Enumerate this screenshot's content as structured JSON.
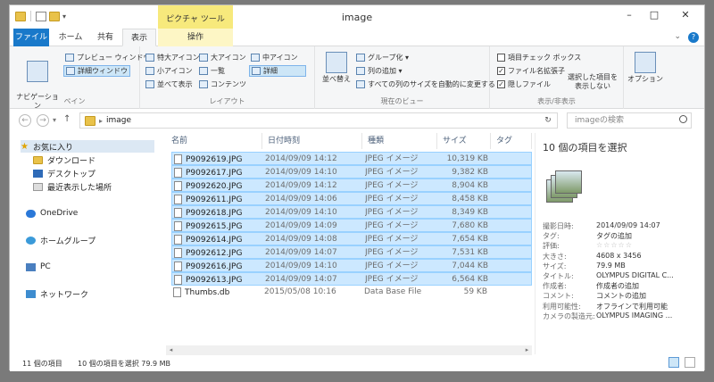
{
  "window": {
    "title": "image",
    "context_tab_title": "ピクチャ ツール",
    "minimize": "–",
    "maximize": "□",
    "close": "✕"
  },
  "ribbon_tabs": [
    "ファイル",
    "ホーム",
    "共有",
    "表示",
    "操作"
  ],
  "ribbon_right": {
    "collapse": "⌄",
    "help": "?"
  },
  "panes_group": {
    "nav_pane": "ナビゲーション\nウィンドウ ▾",
    "preview": "プレビュー ウィンドウ",
    "details": "詳細ウィンドウ",
    "label": "ペイン"
  },
  "layout_group": {
    "items": [
      "特大アイコン",
      "大アイコン",
      "中アイコン",
      "小アイコン",
      "一覧",
      "詳細",
      "並べて表示",
      "コンテンツ"
    ],
    "label": "レイアウト"
  },
  "current_view_group": {
    "sort": "並べ替え",
    "group_by": "グループ化 ▾",
    "add_column": "列の追加 ▾",
    "fit_columns": "すべての列のサイズを自動的に変更する",
    "label": "現在のビュー"
  },
  "show_hide_group": {
    "item_checkbox": "項目チェック ボックス",
    "file_ext": "ファイル名拡張子",
    "hidden_files": "隠しファイル",
    "hide_selected": "選択した項目を\n表示しない",
    "label": "表示/非表示"
  },
  "options_label": "オプション",
  "address": {
    "path": "image",
    "search_placeholder": "imageの検索"
  },
  "nav": {
    "favorites": "お気に入り",
    "downloads": "ダウンロード",
    "desktop": "デスクトップ",
    "recent": "最近表示した場所",
    "onedrive": "OneDrive",
    "homegroup": "ホームグループ",
    "pc": "PC",
    "network": "ネットワーク"
  },
  "columns": {
    "name": "名前",
    "date": "日付時刻",
    "type": "種類",
    "size": "サイズ",
    "tag": "タグ"
  },
  "files": [
    {
      "name": "P9092619.JPG",
      "date": "2014/09/09 14:12",
      "type": "JPEG イメージ",
      "size": "10,319 KB",
      "selected": true
    },
    {
      "name": "P9092617.JPG",
      "date": "2014/09/09 14:10",
      "type": "JPEG イメージ",
      "size": "9,382 KB",
      "selected": true
    },
    {
      "name": "P9092620.JPG",
      "date": "2014/09/09 14:12",
      "type": "JPEG イメージ",
      "size": "8,904 KB",
      "selected": true
    },
    {
      "name": "P9092611.JPG",
      "date": "2014/09/09 14:06",
      "type": "JPEG イメージ",
      "size": "8,458 KB",
      "selected": true
    },
    {
      "name": "P9092618.JPG",
      "date": "2014/09/09 14:10",
      "type": "JPEG イメージ",
      "size": "8,349 KB",
      "selected": true
    },
    {
      "name": "P9092615.JPG",
      "date": "2014/09/09 14:09",
      "type": "JPEG イメージ",
      "size": "7,680 KB",
      "selected": true
    },
    {
      "name": "P9092614.JPG",
      "date": "2014/09/09 14:08",
      "type": "JPEG イメージ",
      "size": "7,654 KB",
      "selected": true
    },
    {
      "name": "P9092612.JPG",
      "date": "2014/09/09 14:07",
      "type": "JPEG イメージ",
      "size": "7,531 KB",
      "selected": true
    },
    {
      "name": "P9092616.JPG",
      "date": "2014/09/09 14:10",
      "type": "JPEG イメージ",
      "size": "7,044 KB",
      "selected": true
    },
    {
      "name": "P9092613.JPG",
      "date": "2014/09/09 14:07",
      "type": "JPEG イメージ",
      "size": "6,564 KB",
      "selected": true
    },
    {
      "name": "Thumbs.db",
      "date": "2015/05/08 10:16",
      "type": "Data Base File",
      "size": "59 KB",
      "selected": false
    }
  ],
  "details": {
    "title": "10 個の項目を選択",
    "props": [
      {
        "label": "撮影日時:",
        "value": "2014/09/09 14:07"
      },
      {
        "label": "タグ:",
        "value": "タグの追加"
      },
      {
        "label": "評価:",
        "value": "☆☆☆☆☆"
      },
      {
        "label": "大きさ:",
        "value": "4608 x 3456"
      },
      {
        "label": "サイズ:",
        "value": "79.9 MB"
      },
      {
        "label": "タイトル:",
        "value": "OLYMPUS DIGITAL C..."
      },
      {
        "label": "作成者:",
        "value": "作成者の追加"
      },
      {
        "label": "コメント:",
        "value": "コメントの追加"
      },
      {
        "label": "利用可能性:",
        "value": "オフラインで利用可能"
      },
      {
        "label": "カメラの製造元:",
        "value": "OLYMPUS IMAGING ..."
      }
    ]
  },
  "status": {
    "count": "11 個の項目",
    "selected": "10 個の項目を選択  79.9 MB"
  }
}
